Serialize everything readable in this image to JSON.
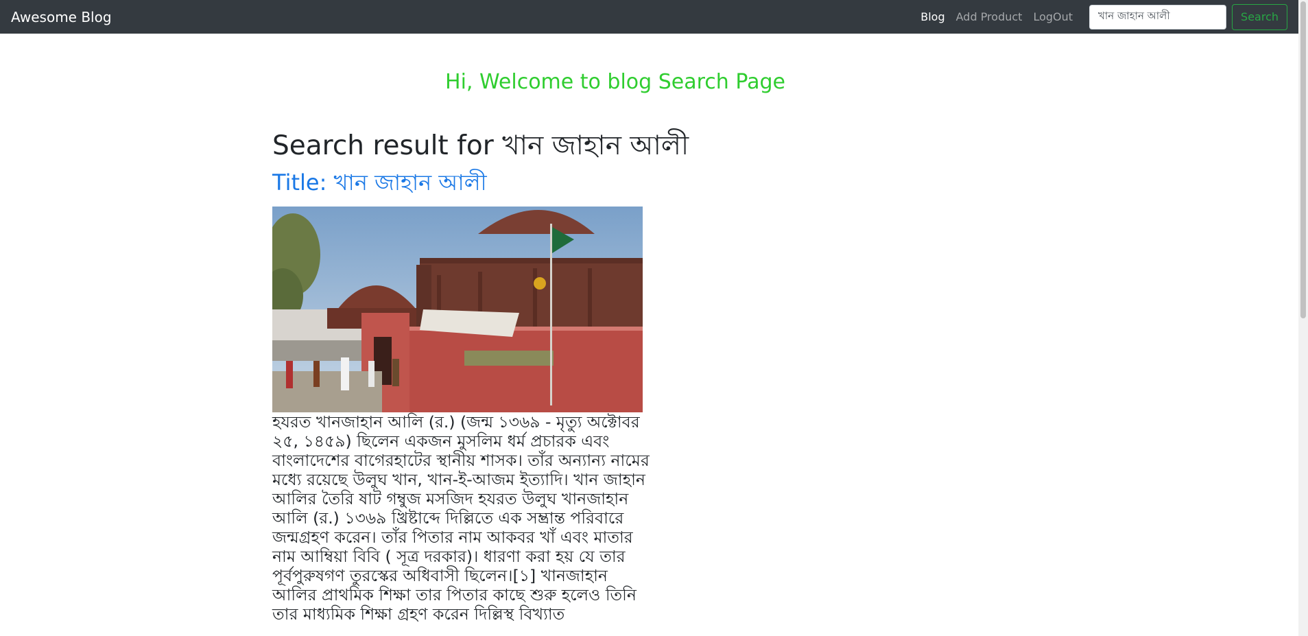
{
  "navbar": {
    "brand": "Awesome Blog",
    "links": [
      {
        "label": "Blog",
        "active": true
      },
      {
        "label": "Add Product",
        "active": false
      },
      {
        "label": "LogOut",
        "active": false
      }
    ],
    "search_value": "খান জাহান আলী",
    "search_button": "Search"
  },
  "welcome": "Hi, Welcome to blog Search Page",
  "result": {
    "heading": "Search result for খান জাহান আলী",
    "title": "Title: খান জাহান আলী",
    "body": "হযরত খানজাহান আলি (র.) (জন্ম ১৩৬৯ - মৃত্যু অক্টোবর ২৫, ১৪৫৯) ছিলেন একজন মুসলিম ধর্ম প্রচারক এবং বাংলাদেশের বাগেরহাটের স্থানীয় শাসক। তাঁর অন্যান্য নামের মধ্যে রয়েছে উলুঘ খান, খান-ই-আজম ইত্যাদি। খান জাহান আলির তৈরি ষাট গম্বুজ মসজিদ হযরত উলুঘ খানজাহান আলি (র.) ১৩৬৯ খ্রিষ্টাব্দে দিল্লিতে এক সম্ভ্রান্ত পরিবারে জন্মগ্রহণ করেন। তাঁর পিতার নাম আকবর খাঁ এবং মাতার নাম আম্বিয়া বিবি ( সূত্র দরকার)। ধারণা করা হয় যে তার পূর্বপুরুষগণ তুরস্কের অধিবাসী ছিলেন।[১] খানজাহান আলির প্রাথমিক শিক্ষা তার পিতার কাছে শুরু হলেও তিনি তার মাধ্যমিক শিক্ষা গ্রহণ করেন দিল্লিস্থ বিখ্যাত"
  },
  "colors": {
    "navbar_bg": "#343a40",
    "welcome": "#2fcd2f",
    "title": "#1a78e6",
    "search_button": "#28a745"
  }
}
